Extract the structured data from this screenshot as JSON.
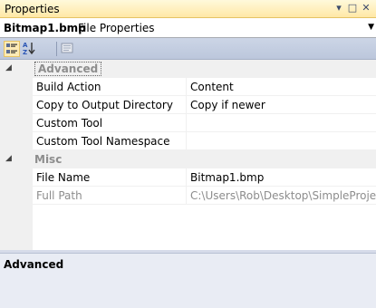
{
  "window": {
    "title": "Properties",
    "pin_glyph": "▾",
    "maximize_glyph": "□",
    "close_glyph": "✕"
  },
  "object": {
    "name": "Bitmap1.bmp",
    "type": "File Properties"
  },
  "toolbar": {
    "categorized_icon": "categorized-icon",
    "alphabetical_icon": "sort-az-icon",
    "property_pages_icon": "property-pages-icon"
  },
  "categories": [
    {
      "label": "Advanced",
      "expand_glyph": "◢",
      "properties": [
        {
          "name": "Build Action",
          "value": "Content"
        },
        {
          "name": "Copy to Output Directory",
          "value": "Copy if newer"
        },
        {
          "name": "Custom Tool",
          "value": ""
        },
        {
          "name": "Custom Tool Namespace",
          "value": ""
        }
      ]
    },
    {
      "label": "Misc",
      "expand_glyph": "◢",
      "properties": [
        {
          "name": "File Name",
          "value": "Bitmap1.bmp"
        },
        {
          "name": "Full Path",
          "value": "C:\\Users\\Rob\\Desktop\\SimpleProjec"
        }
      ]
    }
  ],
  "description": {
    "title": "Advanced"
  },
  "colors": {
    "titlebar_gold": "#ffe8a6",
    "toolbar_blue": "#bcc7dc",
    "readonly_gray": "#8d8d8d"
  }
}
